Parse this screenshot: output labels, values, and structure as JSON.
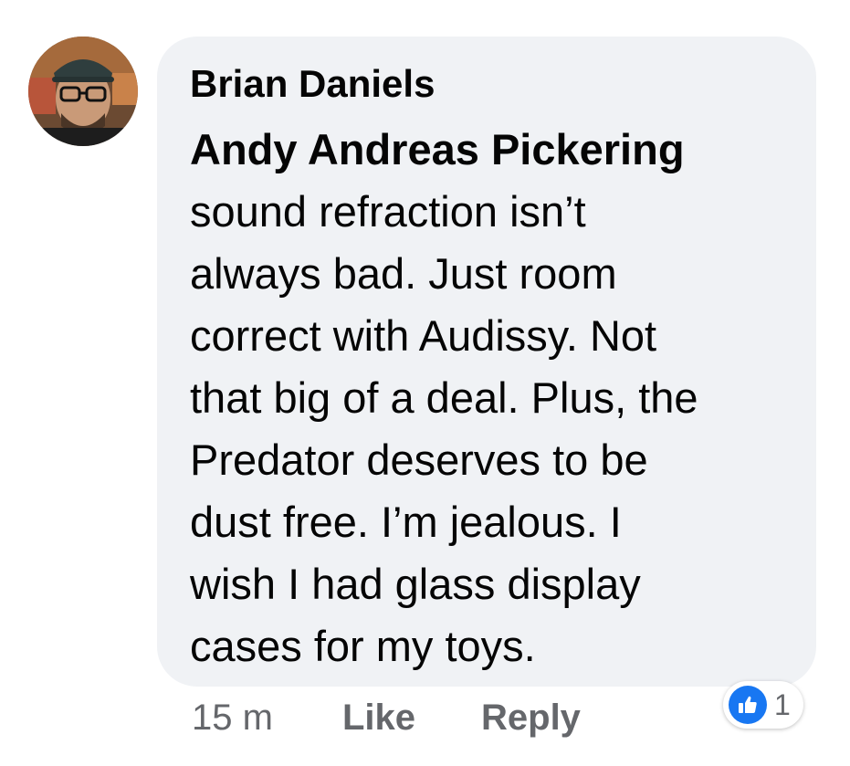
{
  "comment": {
    "author": "Brian Daniels",
    "mention": "Andy Andreas Pickering",
    "text": "sound refraction isn’t\nalways bad. Just room\ncorrect with Audissy. Not\nthat big of a deal. Plus, the\nPredator deserves to be\ndust free. I’m jealous. I\nwish I had glass display\ncases for my toys.",
    "timestamp": "15 m",
    "like_label": "Like",
    "reply_label": "Reply",
    "reaction_count": "1",
    "reaction_icon": "thumbs-up-icon"
  },
  "colors": {
    "bubble": "#f0f2f5",
    "text": "#050505",
    "secondary_text": "#65676b",
    "like_blue": "#1877f2"
  }
}
